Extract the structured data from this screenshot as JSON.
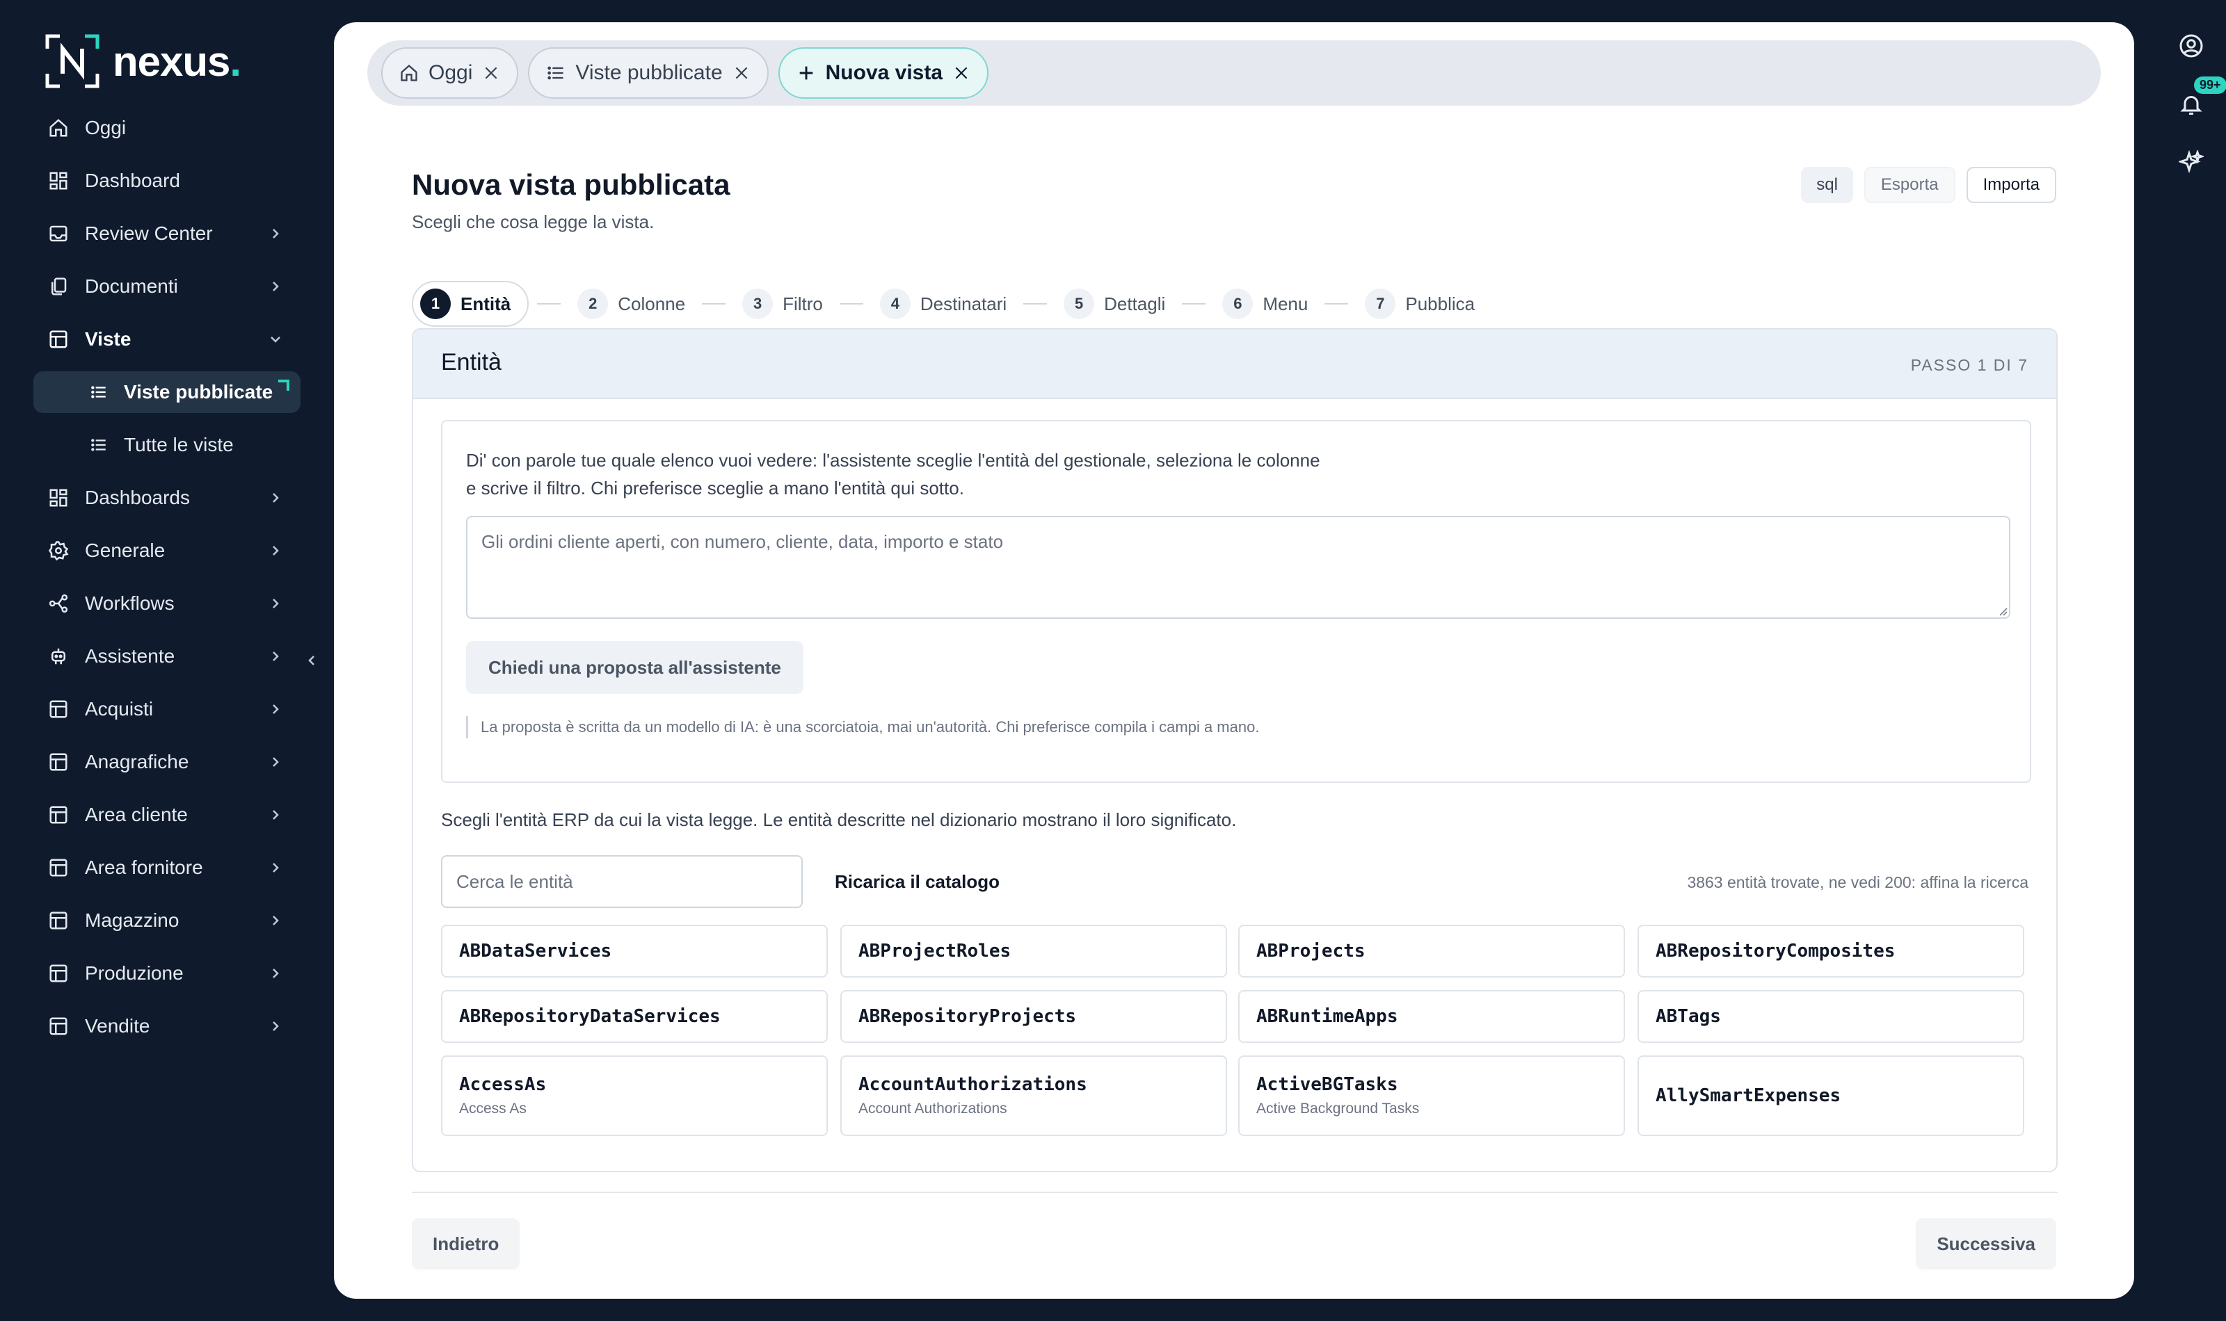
{
  "brand": {
    "name": "nexus",
    "dot": ".",
    "accent": "#2dd4bf"
  },
  "sidebar": {
    "items": [
      {
        "label": "Oggi",
        "icon": "home-icon"
      },
      {
        "label": "Dashboard",
        "icon": "dashboard-icon"
      },
      {
        "label": "Review Center",
        "icon": "inbox-icon"
      },
      {
        "label": "Documenti",
        "icon": "documents-icon"
      },
      {
        "label": "Viste",
        "icon": "table-icon"
      },
      {
        "label": "Dashboards",
        "icon": "dashboard-icon"
      },
      {
        "label": "Generale",
        "icon": "gear-icon"
      },
      {
        "label": "Workflows",
        "icon": "workflow-icon"
      },
      {
        "label": "Assistente",
        "icon": "robot-icon"
      },
      {
        "label": "Acquisti",
        "icon": "table-icon"
      },
      {
        "label": "Anagrafiche",
        "icon": "table-icon"
      },
      {
        "label": "Area cliente",
        "icon": "table-icon"
      },
      {
        "label": "Area fornitore",
        "icon": "table-icon"
      },
      {
        "label": "Magazzino",
        "icon": "table-icon"
      },
      {
        "label": "Produzione",
        "icon": "table-icon"
      },
      {
        "label": "Vendite",
        "icon": "table-icon"
      }
    ],
    "sub_items": [
      {
        "label": "Viste pubblicate",
        "active": true
      },
      {
        "label": "Tutte le viste",
        "active": false
      }
    ]
  },
  "rail": {
    "notifications_badge": "99+"
  },
  "tabs": [
    {
      "label": "Oggi"
    },
    {
      "label": "Viste pubblicate"
    },
    {
      "label": "Nuova vista"
    }
  ],
  "page": {
    "title": "Nuova vista pubblicata",
    "subtitle": "Scegli che cosa legge la vista.",
    "actions": {
      "sql": "sql",
      "export": "Esporta",
      "import": "Importa"
    }
  },
  "stepper": [
    {
      "num": "1",
      "label": "Entità"
    },
    {
      "num": "2",
      "label": "Colonne"
    },
    {
      "num": "3",
      "label": "Filtro"
    },
    {
      "num": "4",
      "label": "Destinatari"
    },
    {
      "num": "5",
      "label": "Dettagli"
    },
    {
      "num": "6",
      "label": "Menu"
    },
    {
      "num": "7",
      "label": "Pubblica"
    }
  ],
  "card": {
    "title": "Entità",
    "step_indicator": "PASSO 1 DI 7",
    "assistant": {
      "intro": "Di' con parole tue quale elenco vuoi vedere: l'assistente sceglie l'entità del gestionale, seleziona le colonne e scrive il filtro. Chi preferisce sceglie a mano l'entità qui sotto.",
      "placeholder": "Gli ordini cliente aperti, con numero, cliente, data, importo e stato",
      "button": "Chiedi una proposta all'assistente",
      "disclaimer": "La proposta è scritta da un modello di IA: è una scorciatoia, mai un'autorità. Chi preferisce compila i campi a mano."
    },
    "entities": {
      "intro": "Scegli l'entità ERP da cui la vista legge. Le entità descritte nel dizionario mostrano il loro significato.",
      "search_placeholder": "Cerca le entità",
      "reload_button": "Ricarica il catalogo",
      "count_text": "3863 entità trovate, ne vedi 200: affina la ricerca",
      "items": [
        {
          "name": "ABDataServices",
          "desc": ""
        },
        {
          "name": "ABProjectRoles",
          "desc": ""
        },
        {
          "name": "ABProjects",
          "desc": ""
        },
        {
          "name": "ABRepositoryComposites",
          "desc": ""
        },
        {
          "name": "ABRepositoryDataServices",
          "desc": ""
        },
        {
          "name": "ABRepositoryProjects",
          "desc": ""
        },
        {
          "name": "ABRuntimeApps",
          "desc": ""
        },
        {
          "name": "ABTags",
          "desc": ""
        },
        {
          "name": "AccessAs",
          "desc": "Access As"
        },
        {
          "name": "AccountAuthorizations",
          "desc": "Account Authorizations"
        },
        {
          "name": "ActiveBGTasks",
          "desc": "Active Background Tasks"
        },
        {
          "name": "AllySmartExpenses",
          "desc": ""
        }
      ]
    }
  },
  "footer": {
    "back": "Indietro",
    "next": "Successiva"
  }
}
